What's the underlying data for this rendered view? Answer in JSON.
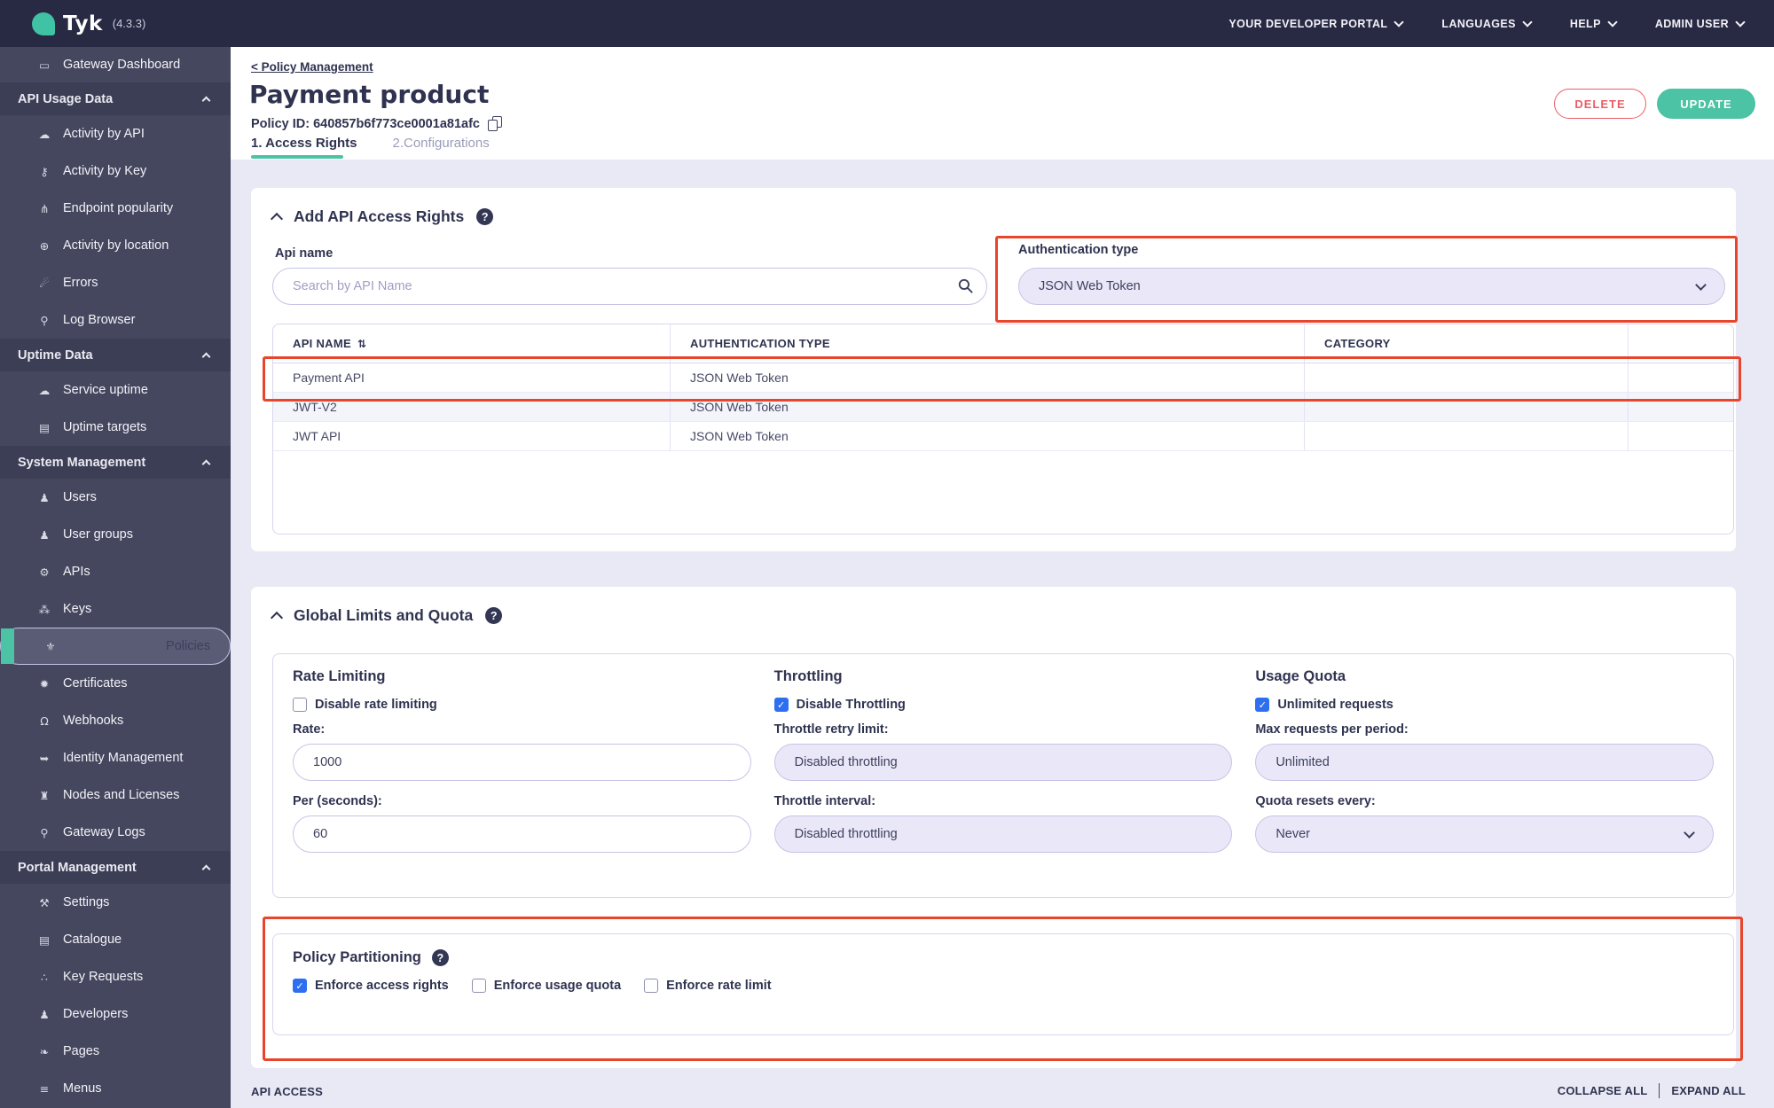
{
  "topbar": {
    "brand": "Tyk",
    "version": "(4.3.3)",
    "menus": [
      {
        "label": "YOUR DEVELOPER PORTAL"
      },
      {
        "label": "LANGUAGES"
      },
      {
        "label": "HELP"
      },
      {
        "label": "ADMIN USER"
      }
    ]
  },
  "sidebar": {
    "items": [
      {
        "label": "Gateway Dashboard",
        "glyph": "▭"
      },
      {
        "label": "API Usage Data",
        "section": true
      },
      {
        "label": "Activity by API",
        "glyph": "☁"
      },
      {
        "label": "Activity by Key",
        "glyph": "⚷"
      },
      {
        "label": "Endpoint popularity",
        "glyph": "⋔"
      },
      {
        "label": "Activity by location",
        "glyph": "⊕"
      },
      {
        "label": "Errors",
        "glyph": "☄"
      },
      {
        "label": "Log Browser",
        "glyph": "⚲"
      },
      {
        "label": "Uptime Data",
        "section": true
      },
      {
        "label": "Service uptime",
        "glyph": "☁"
      },
      {
        "label": "Uptime targets",
        "glyph": "▤"
      },
      {
        "label": "System Management",
        "section": true
      },
      {
        "label": "Users",
        "glyph": "♟"
      },
      {
        "label": "User groups",
        "glyph": "♟"
      },
      {
        "label": "APIs",
        "glyph": "⚙"
      },
      {
        "label": "Keys",
        "glyph": "⁂"
      },
      {
        "label": "Policies",
        "glyph": "⚜",
        "selected": true
      },
      {
        "label": "Certificates",
        "glyph": "✹"
      },
      {
        "label": "Webhooks",
        "glyph": "Ω"
      },
      {
        "label": "Identity Management",
        "glyph": "➥"
      },
      {
        "label": "Nodes and Licenses",
        "glyph": "♜"
      },
      {
        "label": "Gateway Logs",
        "glyph": "⚲"
      },
      {
        "label": "Portal Management",
        "section": true
      },
      {
        "label": "Settings",
        "glyph": "⚒"
      },
      {
        "label": "Catalogue",
        "glyph": "▤"
      },
      {
        "label": "Key Requests",
        "glyph": "∴"
      },
      {
        "label": "Developers",
        "glyph": "♟"
      },
      {
        "label": "Pages",
        "glyph": "❧"
      },
      {
        "label": "Menus",
        "glyph": "≡"
      }
    ]
  },
  "header": {
    "breadcrumb": "< Policy Management",
    "title": "Payment product",
    "policy_id": "Policy ID: 640857b6f773ce0001a81afc",
    "tabs": [
      {
        "label": "1. Access Rights",
        "active": true
      },
      {
        "label": "2.Configurations",
        "active": false
      }
    ],
    "delete_label": "DELETE",
    "update_label": "UPDATE"
  },
  "access_rights": {
    "title": "Add API Access Rights",
    "api_name_label": "Api name",
    "search_placeholder": "Search by API Name",
    "auth_label": "Authentication type",
    "auth_value": "JSON Web Token",
    "table": {
      "columns": [
        "API NAME",
        "AUTHENTICATION TYPE",
        "CATEGORY",
        ""
      ],
      "rows": [
        {
          "name": "Payment API",
          "auth": "JSON Web Token",
          "category": ""
        },
        {
          "name": "JWT-V2",
          "auth": "JSON Web Token",
          "category": ""
        },
        {
          "name": "JWT API",
          "auth": "JSON Web Token",
          "category": ""
        }
      ]
    }
  },
  "limits": {
    "title": "Global Limits and Quota",
    "rate": {
      "title": "Rate Limiting",
      "checkbox": "Disable rate limiting",
      "checked": false,
      "rate_label": "Rate:",
      "rate_value": "1000",
      "per_label": "Per (seconds):",
      "per_value": "60"
    },
    "throttle": {
      "title": "Throttling",
      "checkbox": "Disable Throttling",
      "checked": true,
      "retry_label": "Throttle retry limit:",
      "retry_value": "Disabled throttling",
      "interval_label": "Throttle interval:",
      "interval_value": "Disabled throttling"
    },
    "quota": {
      "title": "Usage Quota",
      "checkbox": "Unlimited requests",
      "checked": true,
      "max_label": "Max requests per period:",
      "max_value": "Unlimited",
      "reset_label": "Quota resets every:",
      "reset_value": "Never"
    }
  },
  "partitioning": {
    "title": "Policy Partitioning",
    "options": [
      {
        "label": "Enforce access rights",
        "checked": true
      },
      {
        "label": "Enforce usage quota",
        "checked": false
      },
      {
        "label": "Enforce rate limit",
        "checked": false
      }
    ]
  },
  "footer": {
    "section_label": "API ACCESS",
    "collapse": "COLLAPSE ALL",
    "expand": "EXPAND ALL"
  },
  "icons": {
    "check": "✓",
    "sort": "⇅",
    "help": "?"
  },
  "colors": {
    "accent_teal": "#4cc3a4",
    "annotation_red": "#e8462c",
    "delete_red": "#ea5d67",
    "checkbox_blue": "#2d6ff0",
    "topbar_bg": "#282a44",
    "sidebar_bg": "#45475f",
    "page_bg": "#e9e9f5"
  }
}
